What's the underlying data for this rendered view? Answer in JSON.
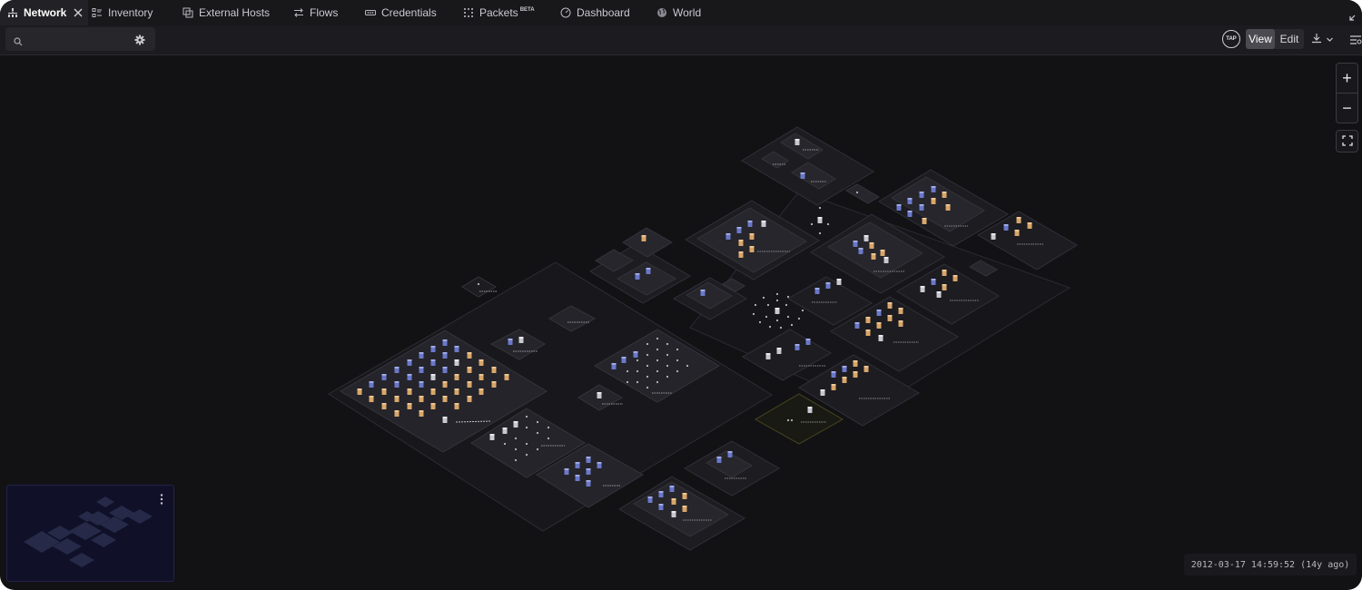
{
  "tabs": [
    {
      "label": "Network",
      "icon": "network-icon",
      "active": true
    },
    {
      "label": "Inventory",
      "icon": "inventory-icon"
    },
    {
      "label": "External Hosts",
      "icon": "external-hosts-icon"
    },
    {
      "label": "Flows",
      "icon": "flows-icon"
    },
    {
      "label": "Credentials",
      "icon": "credentials-icon"
    },
    {
      "label": "Packets",
      "icon": "packets-icon",
      "badge": "BETA"
    },
    {
      "label": "Dashboard",
      "icon": "dashboard-icon"
    },
    {
      "label": "World",
      "icon": "world-icon"
    }
  ],
  "toolbar": {
    "search_value": "",
    "tap_label": "TAP",
    "view_label": "View",
    "edit_label": "Edit",
    "mode_selected": "View"
  },
  "zoom": {
    "in_label": "+",
    "out_label": "−"
  },
  "timestamp": "2012-03-17 14:59:52 (14y ago)",
  "colors": {
    "background": "#121215",
    "node_blue": "#6b78c9",
    "node_orange": "#d8a66a",
    "node_grey": "#c8c8d0",
    "highlight": "#e8b84a"
  }
}
